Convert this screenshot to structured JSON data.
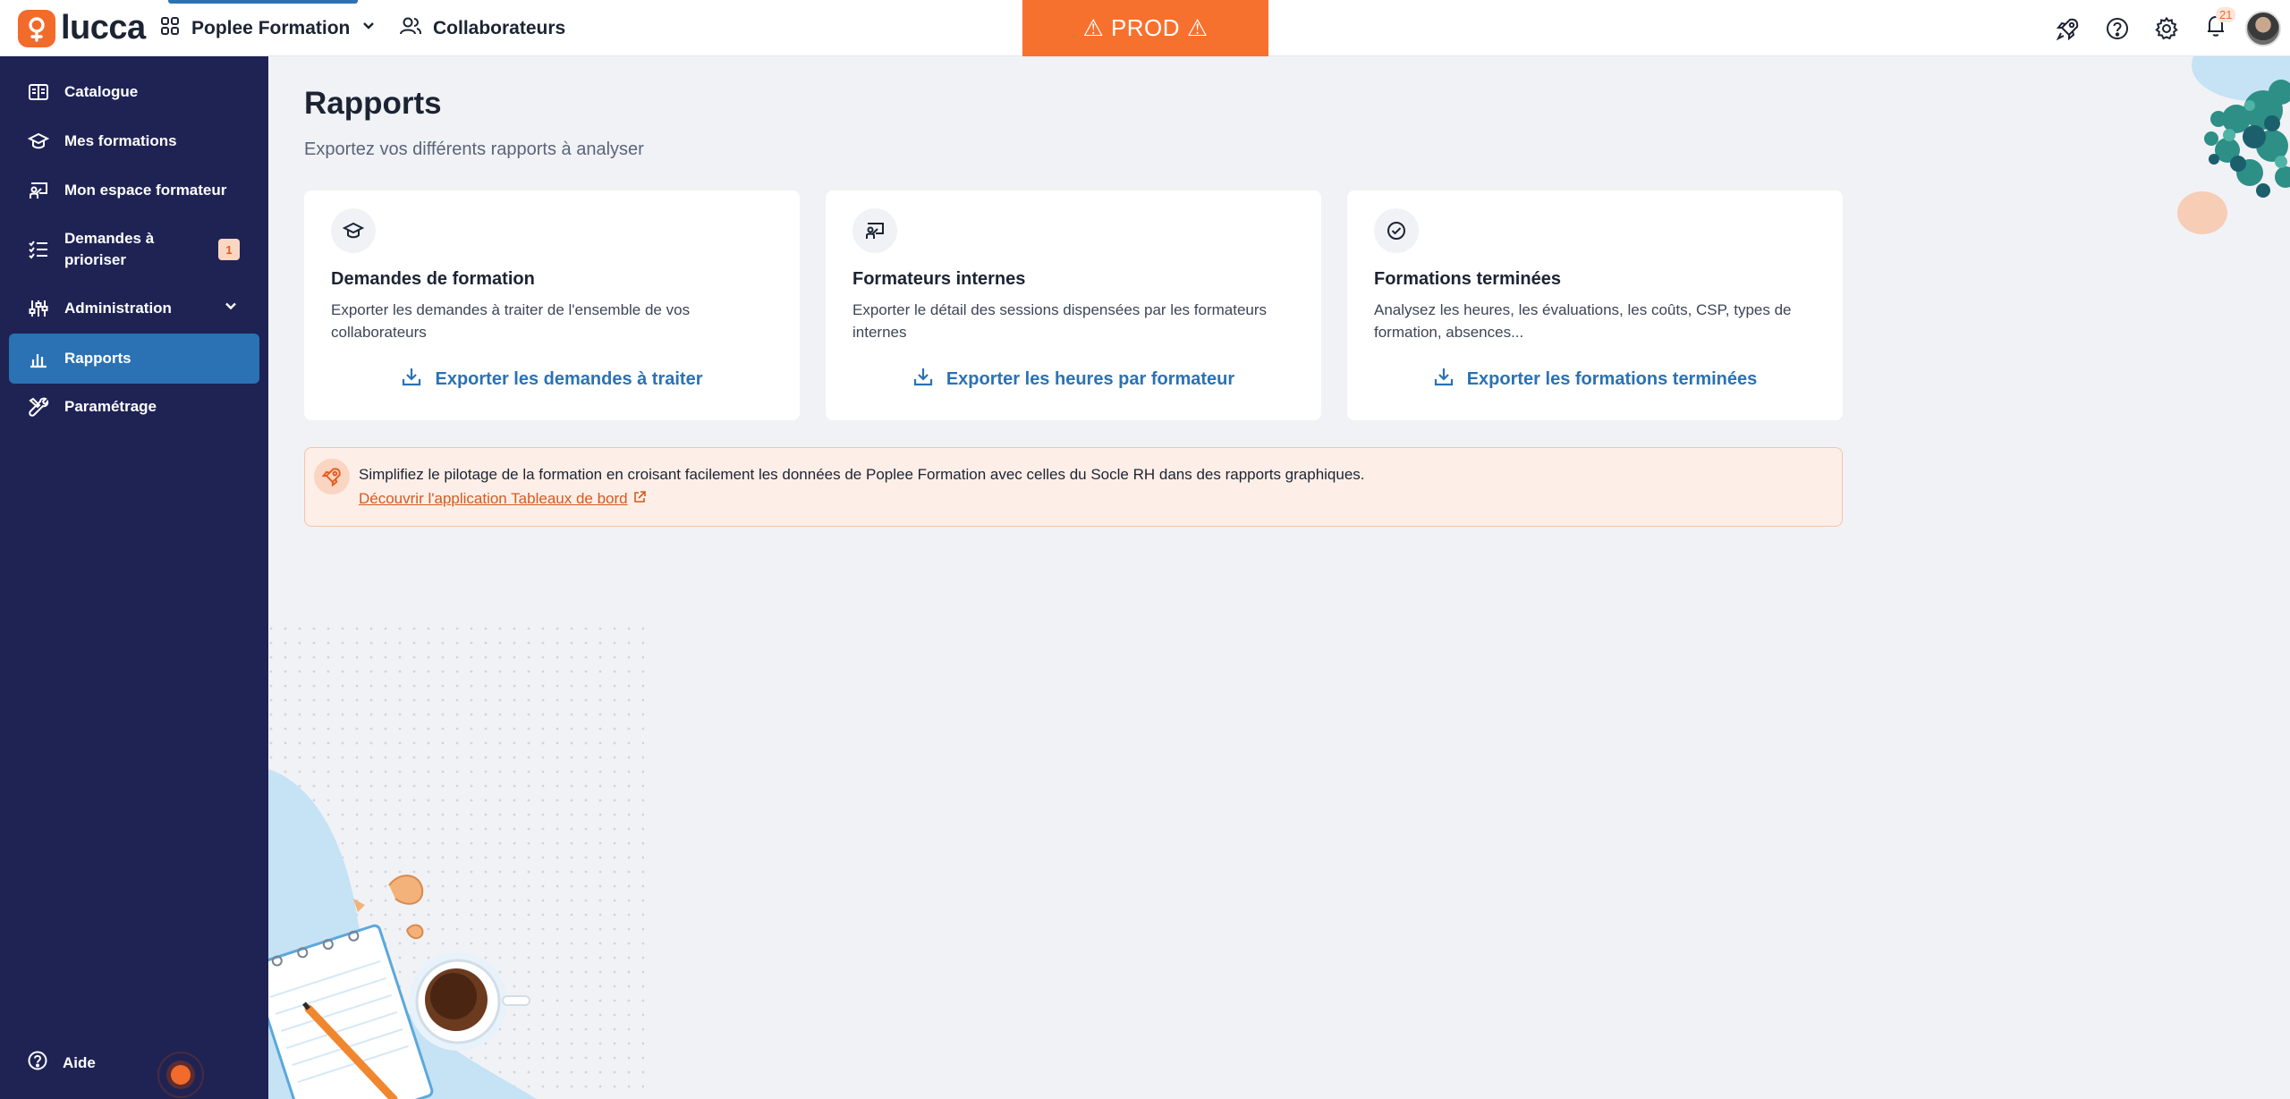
{
  "topbar": {
    "logo_text": "lucca",
    "app_name": "Poplee Formation",
    "collaborators_label": "Collaborateurs",
    "env_banner": "⚠ PROD ⚠",
    "notification_count": "21",
    "icons": [
      "rocket-icon",
      "help-icon",
      "settings-icon",
      "bell-icon"
    ]
  },
  "sidebar": {
    "items": [
      {
        "label": "Catalogue",
        "icon": "book-icon"
      },
      {
        "label": "Mes formations",
        "icon": "graduation-cap-icon"
      },
      {
        "label": "Mon espace formateur",
        "icon": "trainer-board-icon"
      },
      {
        "label": "Demandes à\nprioriser",
        "label_line1": "Demandes à",
        "label_line2": "prioriser",
        "icon": "list-check-icon",
        "badge": "1"
      },
      {
        "label": "Administration",
        "icon": "sliders-icon"
      },
      {
        "label": "Rapports",
        "icon": "bar-chart-icon",
        "active": true
      },
      {
        "label": "Paramétrage",
        "icon": "tools-icon"
      }
    ],
    "help_label": "Aide"
  },
  "main": {
    "title": "Rapports",
    "subtitle": "Exportez vos différents rapports à analyser",
    "cards": [
      {
        "title": "Demandes de formation",
        "description": "Exporter les demandes à traiter de l'ensemble de vos collaborateurs",
        "action": "Exporter les demandes à traiter",
        "icon": "graduation-cap-icon"
      },
      {
        "title": "Formateurs internes",
        "description": "Exporter le détail des sessions dispensées par les formateurs internes",
        "action": "Exporter les heures par formateur",
        "icon": "trainer-board-icon"
      },
      {
        "title": "Formations terminées",
        "description": "Analysez les heures, les évaluations, les coûts, CSP, types de formation, absences...",
        "action": "Exporter les formations terminées",
        "icon": "check-circle-icon"
      }
    ],
    "callout": {
      "text": "Simplifiez le pilotage de la formation en croisant facilement les données de Poplee Formation avec celles du Socle RH dans des rapports graphiques.",
      "link": "Découvrir l'application Tableaux de bord"
    }
  },
  "colors": {
    "sidebar_bg": "#1f2354",
    "accent": "#2a72b4",
    "prod_banner": "#f7712e",
    "background": "#f1f2f6"
  }
}
